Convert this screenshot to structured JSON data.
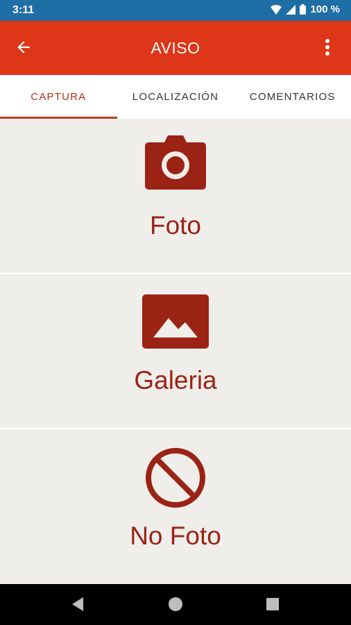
{
  "status_bar": {
    "time": "3:11",
    "battery": "100 %"
  },
  "app_bar": {
    "title": "AVISO",
    "back_icon": "arrow-back-icon",
    "menu_icon": "more-vert-icon"
  },
  "tabs": [
    {
      "label": "CAPTURA",
      "active": true
    },
    {
      "label": "LOCALIZACIÓN",
      "active": false
    },
    {
      "label": "COMENTARIOS",
      "active": false
    }
  ],
  "options": [
    {
      "label": "Foto",
      "icon": "camera-icon"
    },
    {
      "label": "Galeria",
      "icon": "image-icon"
    },
    {
      "label": "No Foto",
      "icon": "block-icon"
    }
  ],
  "colors": {
    "status_bar": "#1e6fa5",
    "app_bar": "#dd3619",
    "accent": "#9b2314",
    "background": "#efeeeb"
  }
}
